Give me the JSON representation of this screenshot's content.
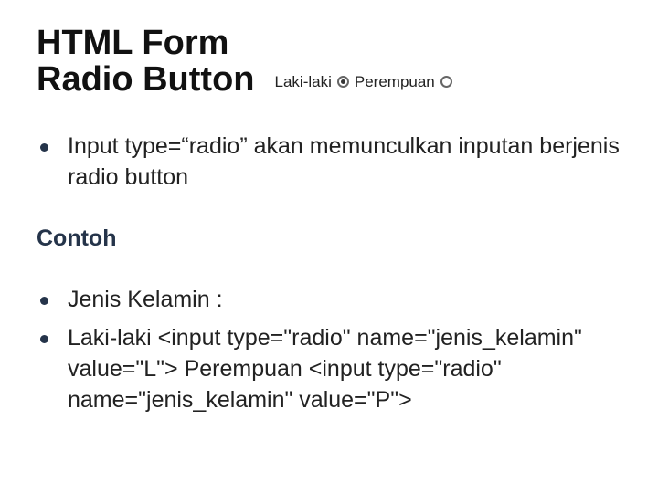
{
  "title_line1": "HTML Form",
  "title_line2": "Radio Button",
  "sample": {
    "label1": "Laki-laki",
    "label2": "Perempuan"
  },
  "bullet1": "Input type=“radio” akan memunculkan inputan berjenis radio button",
  "section_label": "Contoh",
  "bullet2": "Jenis Kelamin :",
  "bullet3": "Laki-laki <input type=\"radio\" name=\"jenis_kelamin\" value=\"L\"> Perempuan <input type=\"radio\" name=\"jenis_kelamin\" value=\"P\">"
}
